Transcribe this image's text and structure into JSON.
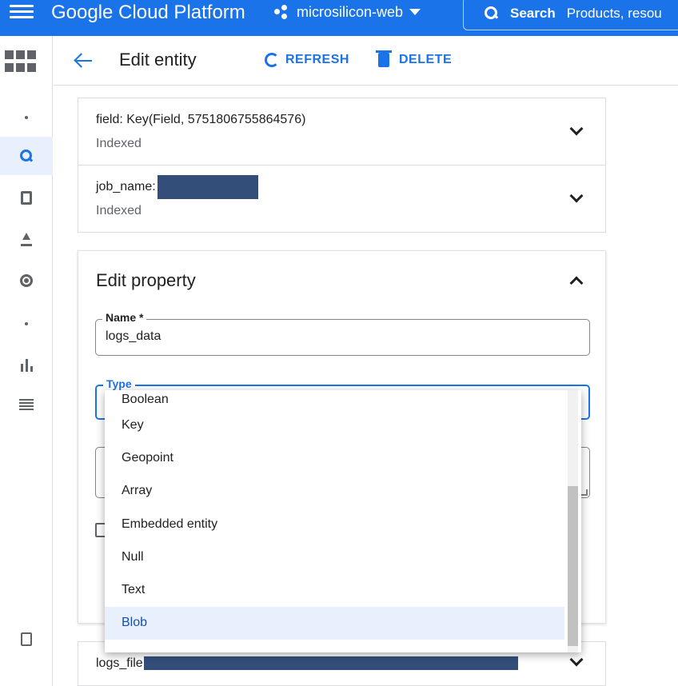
{
  "topbar": {
    "brand": "Google Cloud Platform",
    "project": "microsilicon-web",
    "search_label": "Search",
    "search_placeholder": "Products, resou"
  },
  "rail": {
    "items": [
      "apps-grid-icon",
      "dot-icon",
      "search-icon",
      "document-icon",
      "upload-icon",
      "settings-icon",
      "dot-icon",
      "bar-chart-icon",
      "table-icon",
      "notes-icon"
    ],
    "active": "search-icon"
  },
  "header": {
    "title": "Edit entity",
    "refresh_label": "REFRESH",
    "delete_label": "DELETE"
  },
  "properties": [
    {
      "name": "field:  Key(Field, 5751806755864576)",
      "index": "Indexed"
    },
    {
      "name": "job_name:",
      "index": "Indexed"
    }
  ],
  "edit_property": {
    "title": "Edit property",
    "name_label": "Name *",
    "name_value": "logs_data",
    "type_label": "Type"
  },
  "type_options": [
    "Boolean",
    "Key",
    "Geopoint",
    "Array",
    "Embedded entity",
    "Null",
    "Text",
    "Blob"
  ],
  "selected_type": "Blob",
  "bottom_row": {
    "name": "logs_file"
  },
  "colors": {
    "brand_blue": "#1a73e8",
    "redaction": "#334e79",
    "selected_bg": "#e8f0fe"
  }
}
